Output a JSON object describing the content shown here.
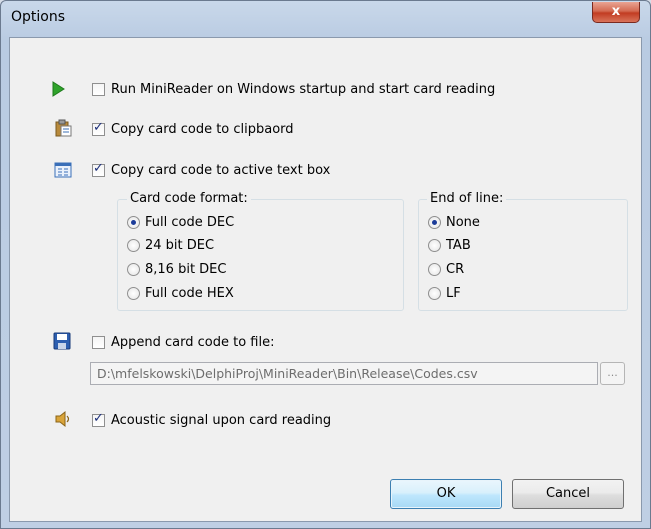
{
  "window": {
    "title": "Options",
    "close_label": "x"
  },
  "options": {
    "run_on_startup": {
      "label": "Run MiniReader on Windows startup and start card reading",
      "checked": false
    },
    "copy_clipboard": {
      "label": "Copy card code to clipbaord",
      "checked": true
    },
    "copy_textbox": {
      "label": "Copy card code to active text box",
      "checked": true
    },
    "append_file": {
      "label": "Append card code to file:",
      "checked": false
    },
    "acoustic": {
      "label": "Acoustic signal upon card reading",
      "checked": true
    }
  },
  "card_code_format": {
    "title": "Card code format:",
    "options": [
      "Full code DEC",
      "24 bit DEC",
      "8,16 bit DEC",
      "Full code HEX"
    ],
    "selected": "Full code DEC"
  },
  "end_of_line": {
    "title": "End of line:",
    "options": [
      "None",
      "TAB",
      "CR",
      "LF"
    ],
    "selected": "None"
  },
  "file_path": {
    "value": "D:\\mfelskowski\\DelphiProj\\MiniReader\\Bin\\Release\\Codes.csv",
    "browse_label": "..."
  },
  "buttons": {
    "ok": "OK",
    "cancel": "Cancel"
  },
  "icons": {
    "run": "play-icon",
    "clipboard": "clipboard-icon",
    "textbox": "textbox-icon",
    "file": "floppy-disk-icon",
    "sound": "speaker-icon"
  }
}
